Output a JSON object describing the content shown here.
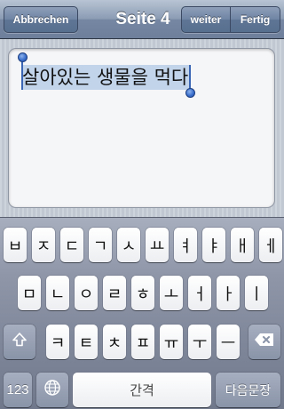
{
  "navbar": {
    "cancel_label": "Abbrechen",
    "title": "Seite 4",
    "next_label": "weiter",
    "done_label": "Fertig"
  },
  "editor": {
    "selected_text": "살아있는 생물을 먹다"
  },
  "keyboard": {
    "row1": [
      "ㅂ",
      "ㅈ",
      "ㄷ",
      "ㄱ",
      "ㅅ",
      "ㅛ",
      "ㅕ",
      "ㅑ",
      "ㅐ",
      "ㅔ"
    ],
    "row2": [
      "ㅁ",
      "ㄴ",
      "ㅇ",
      "ㄹ",
      "ㅎ",
      "ㅗ",
      "ㅓ",
      "ㅏ",
      "ㅣ"
    ],
    "row3": [
      "ㅋ",
      "ㅌ",
      "ㅊ",
      "ㅍ",
      "ㅠ",
      "ㅜ",
      "ㅡ"
    ],
    "numbers_label": "123",
    "space_label": "간격",
    "return_label": "다음문장",
    "icons": {
      "shift": "shift-icon",
      "delete": "delete-icon",
      "globe": "globe-icon"
    }
  },
  "colors": {
    "selection": "#c2d4ea",
    "selection_handle": "#3a6fcc",
    "navbar": "#7587a2"
  }
}
